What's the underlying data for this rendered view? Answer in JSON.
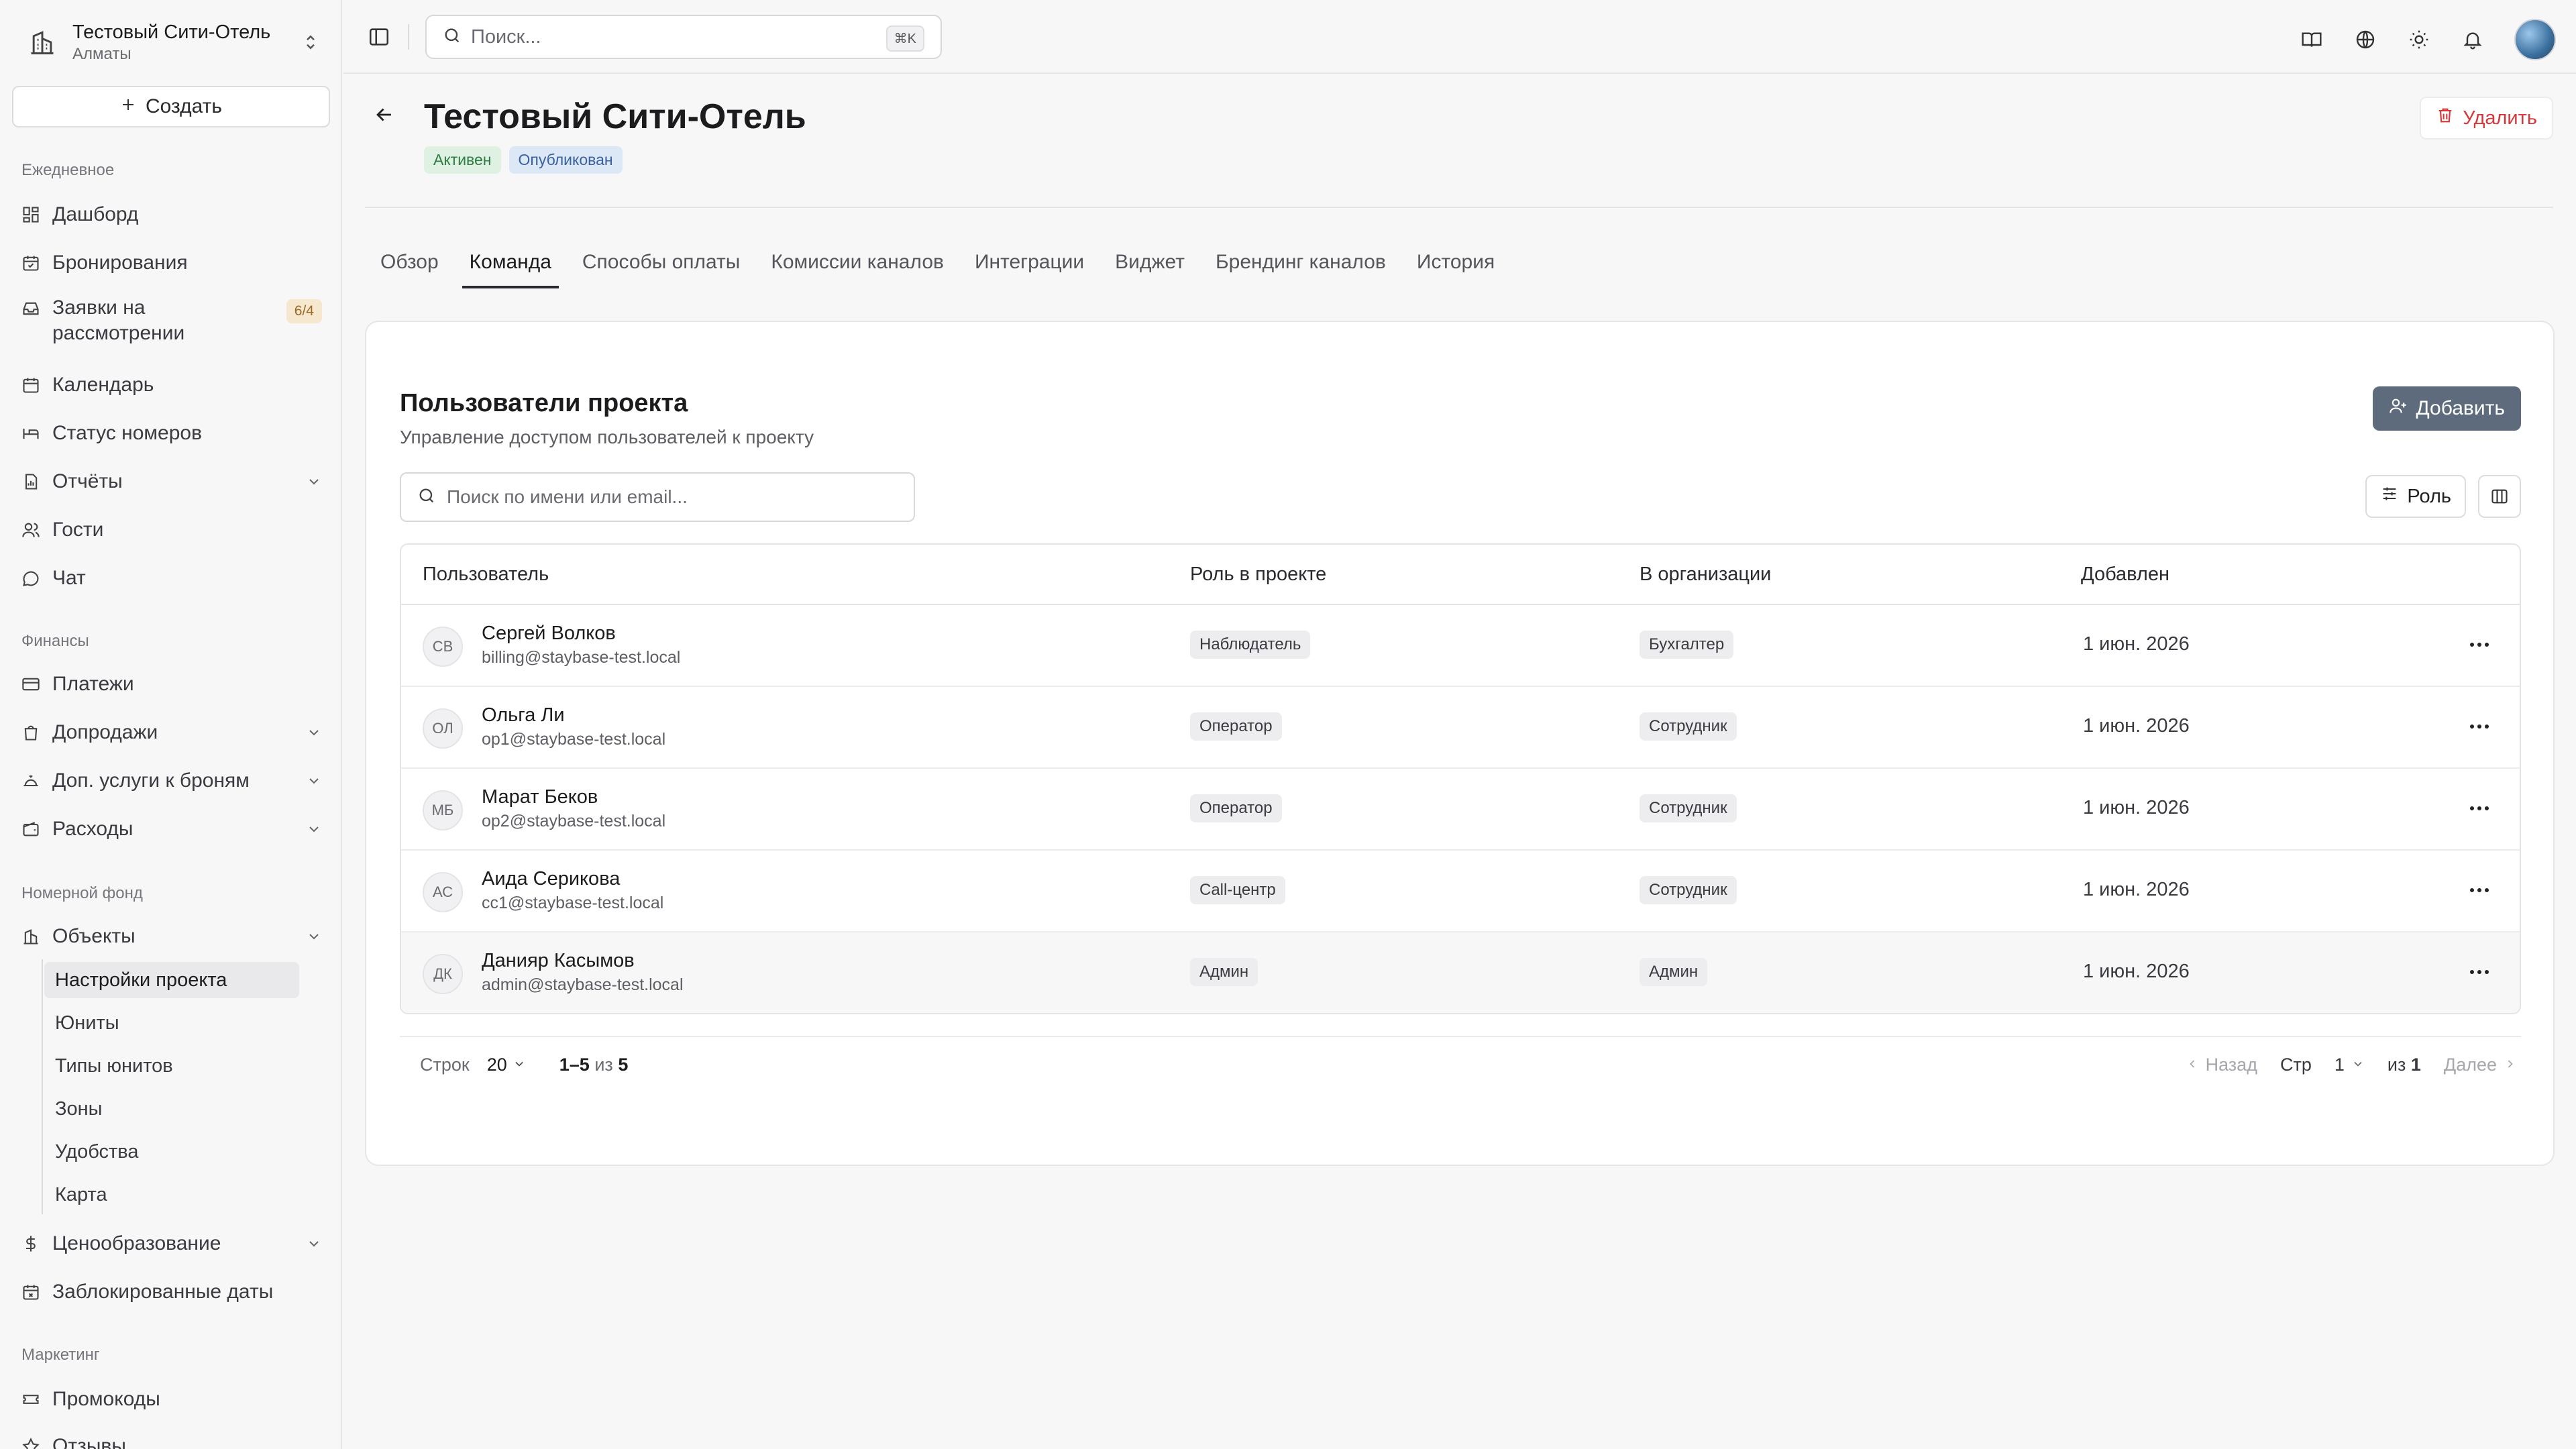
{
  "sidebar": {
    "org_name": "Тестовый Сити-Отель",
    "org_city": "Алматы",
    "create_label": "Создать",
    "sections": {
      "daily": "Ежедневное",
      "finance": "Финансы",
      "rooms": "Номерной фонд",
      "marketing": "Маркетинг"
    },
    "items": {
      "dashboard": "Дашборд",
      "bookings": "Бронирования",
      "requests": "Заявки на рассмотрении",
      "requests_badge": "6/4",
      "calendar": "Календарь",
      "room_status": "Статус номеров",
      "reports": "Отчёты",
      "guests": "Гости",
      "chat": "Чат",
      "payments": "Платежи",
      "upsells": "Допродажи",
      "extra_services": "Доп. услуги к броням",
      "expenses": "Расходы",
      "objects": "Объекты",
      "project_settings": "Настройки проекта",
      "units": "Юниты",
      "unit_types": "Типы юнитов",
      "zones": "Зоны",
      "amenities": "Удобства",
      "map": "Карта",
      "pricing": "Ценообразование",
      "blocked_dates": "Заблокированные даты",
      "promo": "Промокоды",
      "reviews": "Отзывы"
    }
  },
  "topbar": {
    "search_placeholder": "Поиск...",
    "search_shortcut": "⌘K"
  },
  "page": {
    "title": "Тестовый Сити-Отель",
    "badge_active": "Активен",
    "badge_published": "Опубликован",
    "delete_label": "Удалить",
    "tabs": [
      "Обзор",
      "Команда",
      "Способы оплаты",
      "Комиссии каналов",
      "Интеграции",
      "Виджет",
      "Брендинг каналов",
      "История"
    ]
  },
  "team": {
    "title": "Пользователи проекта",
    "subtitle": "Управление доступом пользователей к проекту",
    "add_label": "Добавить",
    "search_placeholder": "Поиск по имени или email...",
    "role_filter": "Роль",
    "columns": {
      "user": "Пользователь",
      "role": "Роль в проекте",
      "org": "В организации",
      "added": "Добавлен"
    },
    "rows": [
      {
        "initials": "СВ",
        "name": "Сергей Волков",
        "email": "billing@staybase-test.local",
        "role": "Наблюдатель",
        "org": "Бухгалтер",
        "added": "1 июн. 2026"
      },
      {
        "initials": "ОЛ",
        "name": "Ольга Ли",
        "email": "op1@staybase-test.local",
        "role": "Оператор",
        "org": "Сотрудник",
        "added": "1 июн. 2026"
      },
      {
        "initials": "МБ",
        "name": "Марат Беков",
        "email": "op2@staybase-test.local",
        "role": "Оператор",
        "org": "Сотрудник",
        "added": "1 июн. 2026"
      },
      {
        "initials": "АС",
        "name": "Аида Серикова",
        "email": "cc1@staybase-test.local",
        "role": "Call-центр",
        "org": "Сотрудник",
        "added": "1 июн. 2026"
      },
      {
        "initials": "ДК",
        "name": "Данияр Касымов",
        "email": "admin@staybase-test.local",
        "role": "Админ",
        "org": "Админ",
        "added": "1 июн. 2026"
      }
    ]
  },
  "pagination": {
    "rows_label": "Строк",
    "rows_value": "20",
    "range": "1–5",
    "of_label": "из",
    "total": "5",
    "prev_label": "Назад",
    "page_label": "Стр",
    "page_value": "1",
    "of_pages_label": "из",
    "pages_total": "1",
    "next_label": "Далее"
  }
}
